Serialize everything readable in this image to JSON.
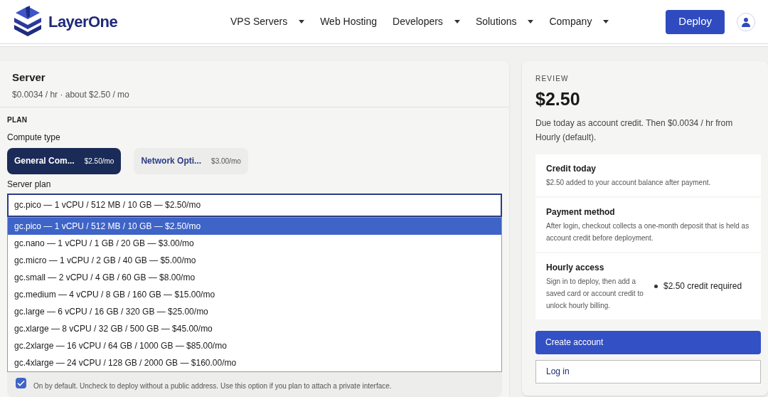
{
  "header": {
    "brand": "LayerOne",
    "nav": [
      {
        "label": "VPS Servers",
        "has_menu": true
      },
      {
        "label": "Web Hosting",
        "has_menu": false
      },
      {
        "label": "Developers",
        "has_menu": true
      },
      {
        "label": "Solutions",
        "has_menu": true
      },
      {
        "label": "Company",
        "has_menu": true
      }
    ],
    "deploy_button": "Deploy"
  },
  "server": {
    "title": "Server",
    "price_line": "$0.0034 / hr · about $2.50 / mo"
  },
  "plan": {
    "heading": "PLAN",
    "compute_label": "Compute type",
    "compute_types": [
      {
        "name": "General Com...",
        "price": "$2.50/mo",
        "selected": true
      },
      {
        "name": "Network Opti...",
        "price": "$3.00/mo",
        "selected": false
      }
    ],
    "server_plan_label": "Server plan",
    "server_plan_value": "gc.pico — 1 vCPU / 512 MB / 10 GB — $2.50/mo",
    "options": [
      {
        "label": "gc.pico — 1 vCPU / 512 MB / 10 GB — $2.50/mo",
        "selected": true
      },
      {
        "label": "gc.nano — 1 vCPU / 1 GB / 20 GB — $3.00/mo",
        "selected": false
      },
      {
        "label": "gc.micro — 1 vCPU / 2 GB / 40 GB — $5.00/mo",
        "selected": false
      },
      {
        "label": "gc.small — 2 vCPU / 4 GB / 60 GB — $8.00/mo",
        "selected": false
      },
      {
        "label": "gc.medium — 4 vCPU / 8 GB / 160 GB — $15.00/mo",
        "selected": false
      },
      {
        "label": "gc.large — 6 vCPU / 16 GB / 320 GB — $25.00/mo",
        "selected": false
      },
      {
        "label": "gc.xlarge — 8 vCPU / 32 GB / 500 GB — $45.00/mo",
        "selected": false
      },
      {
        "label": "gc.2xlarge — 16 vCPU / 64 GB / 1000 GB — $85.00/mo",
        "selected": false
      },
      {
        "label": "gc.4xlarge — 24 vCPU / 128 GB / 2000 GB — $160.00/mo",
        "selected": false
      }
    ]
  },
  "public_ipv4": {
    "checked": true,
    "description": "On by default. Uncheck to deploy without a public address. Use this option if you plan to attach a private interface."
  },
  "review": {
    "heading": "REVIEW",
    "total": "$2.50",
    "note": "Due today as account credit. Then $0.0034 / hr from Hourly (default).",
    "items": [
      {
        "title": "Credit today",
        "text": "$2.50 added to your account balance after payment."
      },
      {
        "title": "Payment method",
        "text": "After login, checkout collects a one-month deposit that is held as account credit before deployment."
      },
      {
        "title": "Hourly access",
        "text": "Sign in to deploy, then add a saved card or account credit to unlock hourly billing.",
        "badge": "$2.50 credit required"
      }
    ],
    "create_button": "Create account",
    "login_button": "Log in"
  }
}
